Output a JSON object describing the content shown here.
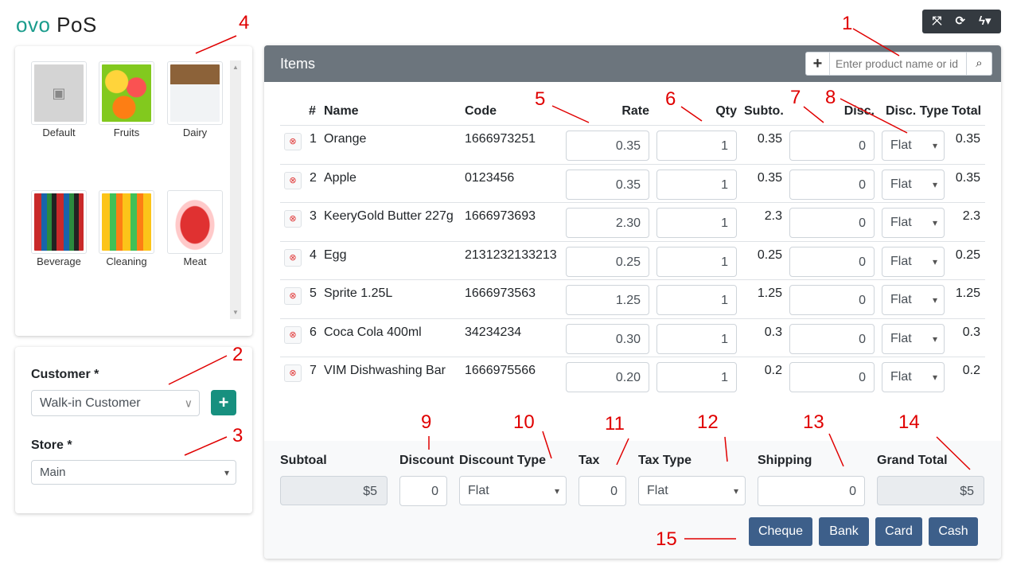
{
  "app": {
    "logo_ovo": "ovo",
    "logo_pos": "PoS"
  },
  "toolbar": {
    "expand_icon": "expand-icon",
    "refresh_icon": "refresh-icon",
    "bolt_icon": "bolt-dropdown-icon"
  },
  "categories": [
    {
      "label": "Default",
      "image": "default"
    },
    {
      "label": "Fruits",
      "image": "fruits"
    },
    {
      "label": "Dairy",
      "image": "dairy"
    },
    {
      "label": "Beverage",
      "image": "beverage"
    },
    {
      "label": "Cleaning",
      "image": "cleaning"
    },
    {
      "label": "Meat",
      "image": "meat"
    }
  ],
  "customer": {
    "label": "Customer *",
    "value": "Walk-in Customer"
  },
  "store": {
    "label": "Store *",
    "value": "Main"
  },
  "items": {
    "title": "Items",
    "search_placeholder": "Enter product name or id",
    "columns": {
      "hash": "#",
      "name": "Name",
      "code": "Code",
      "rate": "Rate",
      "qty": "Qty",
      "subtotal": "Subto.",
      "disc": "Disc.",
      "disc_type": "Disc. Type",
      "total": "Total"
    },
    "rows": [
      {
        "no": "1",
        "name": "Orange",
        "code": "1666973251",
        "rate": "0.35",
        "qty": "1",
        "subtotal": "0.35",
        "disc": "0",
        "disc_type": "Flat",
        "total": "0.35"
      },
      {
        "no": "2",
        "name": "Apple",
        "code": "0123456",
        "rate": "0.35",
        "qty": "1",
        "subtotal": "0.35",
        "disc": "0",
        "disc_type": "Flat",
        "total": "0.35"
      },
      {
        "no": "3",
        "name": "KeeryGold Butter 227g",
        "code": "1666973693",
        "rate": "2.30",
        "qty": "1",
        "subtotal": "2.3",
        "disc": "0",
        "disc_type": "Flat",
        "total": "2.3"
      },
      {
        "no": "4",
        "name": "Egg",
        "code": "2131232133213",
        "rate": "0.25",
        "qty": "1",
        "subtotal": "0.25",
        "disc": "0",
        "disc_type": "Flat",
        "total": "0.25"
      },
      {
        "no": "5",
        "name": "Sprite 1.25L",
        "code": "1666973563",
        "rate": "1.25",
        "qty": "1",
        "subtotal": "1.25",
        "disc": "0",
        "disc_type": "Flat",
        "total": "1.25"
      },
      {
        "no": "6",
        "name": "Coca Cola 400ml",
        "code": "34234234",
        "rate": "0.30",
        "qty": "1",
        "subtotal": "0.3",
        "disc": "0",
        "disc_type": "Flat",
        "total": "0.3"
      },
      {
        "no": "7",
        "name": "VIM Dishwashing Bar",
        "code": "1666975566",
        "rate": "0.20",
        "qty": "1",
        "subtotal": "0.2",
        "disc": "0",
        "disc_type": "Flat",
        "total": "0.2"
      }
    ]
  },
  "summary": {
    "subtotal_label": "Subtoal",
    "subtotal_value": "$5",
    "discount_label": "Discount",
    "discount_value": "0",
    "discount_type_label": "Discount Type",
    "discount_type_value": "Flat",
    "tax_label": "Tax",
    "tax_value": "0",
    "tax_type_label": "Tax Type",
    "tax_type_value": "Flat",
    "shipping_label": "Shipping",
    "shipping_value": "0",
    "grand_total_label": "Grand Total",
    "grand_total_value": "$5"
  },
  "payments": [
    "Cheque",
    "Bank",
    "Card",
    "Cash"
  ],
  "annotations": [
    "1",
    "2",
    "3",
    "4",
    "5",
    "6",
    "7",
    "8",
    "9",
    "10",
    "11",
    "12",
    "13",
    "14",
    "15"
  ],
  "annotation_color": "#e00000",
  "accent_color": "#17907f",
  "payment_color": "#3d5f8a"
}
